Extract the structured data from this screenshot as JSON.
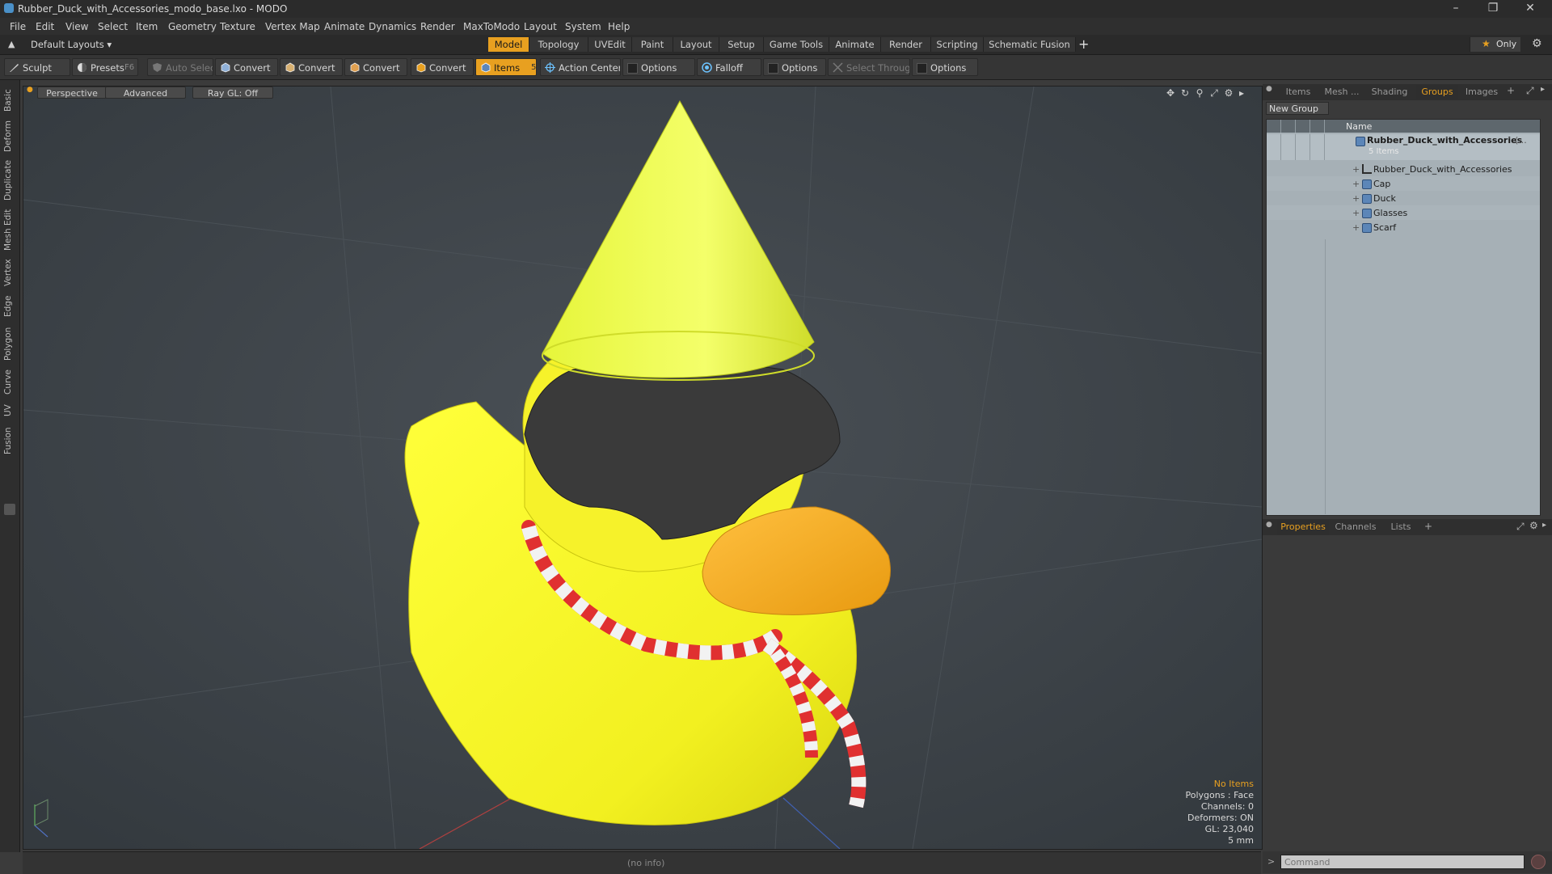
{
  "window": {
    "title": "Rubber_Duck_with_Accessories_modo_base.lxo - MODO",
    "controls": [
      "minimize-icon",
      "restore-icon",
      "close-icon"
    ]
  },
  "menubar": {
    "items": [
      "File",
      "Edit",
      "View",
      "Select",
      "Item",
      "Geometry",
      "Texture",
      "Vertex Map",
      "Animate",
      "Dynamics",
      "Render",
      "MaxToModo",
      "Layout",
      "System",
      "Help"
    ]
  },
  "layoutbar": {
    "layout_selector": "Default Layouts",
    "tabs": [
      "Model",
      "Topology",
      "UVEdit",
      "Paint",
      "Layout",
      "Setup",
      "Game Tools",
      "Animate",
      "Render",
      "Scripting",
      "Schematic Fusion"
    ],
    "active_tab": "Model",
    "add_label": "+",
    "only_label": "Only",
    "accent_color": "#e8a020"
  },
  "toolbar": {
    "sculpt": "Sculpt",
    "presets": "Presets",
    "presets_key": "F6",
    "auto_select": "Auto Select",
    "convert1": "Convert",
    "convert2": "Convert",
    "convert3": "Convert",
    "convert4": "Convert",
    "items": "Items",
    "items_key": "5",
    "action_center": "Action Center",
    "options1": "Options",
    "falloff": "Falloff",
    "options2": "Options",
    "select_through": "Select Through",
    "options3": "Options"
  },
  "lefttabs": [
    "Basic",
    "Deform",
    "Duplicate",
    "Mesh Edit",
    "Vertex",
    "Edge",
    "Polygon",
    "Curve",
    "UV",
    "Fusion"
  ],
  "viewport": {
    "view": "Perspective",
    "shading": "Advanced",
    "raygl": "Ray GL: Off",
    "info": {
      "selection": "No Items",
      "polygons": "Polygons : Face",
      "channels": "Channels: 0",
      "deformers": "Deformers: ON",
      "gl": "GL: 23,040",
      "scale": "5 mm"
    },
    "selection_color": "#e8a020",
    "background_color": "#3c4247"
  },
  "statusbar": {
    "text": "(no info)"
  },
  "toppanel": {
    "tabs": [
      "Items",
      "Mesh ...",
      "Shading",
      "Groups",
      "Images"
    ],
    "active_tab": "Groups",
    "new_group": "New Group",
    "column_name": "Name",
    "root": {
      "name": "Rubber_Duck_with_Accessories",
      "suffix": "(...",
      "count": "5 Items"
    },
    "children": [
      "Rubber_Duck_with_Accessories",
      "Cap",
      "Duck",
      "Glasses",
      "Scarf"
    ]
  },
  "bottompanel": {
    "tabs": [
      "Properties",
      "Channels",
      "Lists"
    ],
    "active_tab": "Properties"
  },
  "command": {
    "placeholder": "Command"
  }
}
